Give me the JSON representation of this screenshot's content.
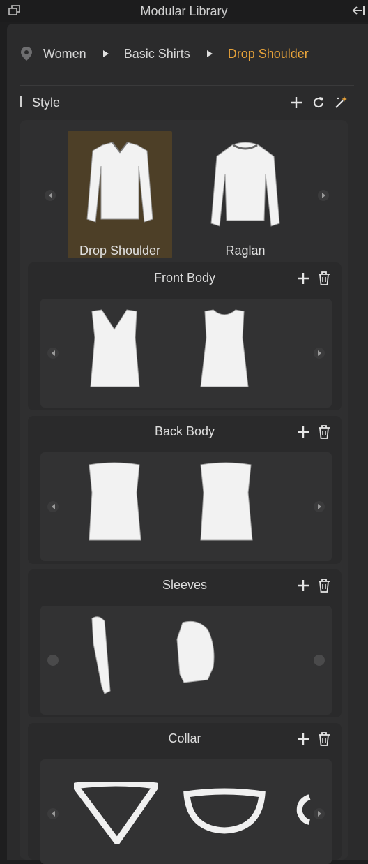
{
  "window": {
    "title": "Modular Library"
  },
  "breadcrumb": {
    "items": [
      "Women",
      "Basic Shirts",
      "Drop Shoulder"
    ]
  },
  "style": {
    "label": "Style",
    "cards": [
      {
        "label": "Drop Shoulder",
        "selected": true
      },
      {
        "label": "Raglan",
        "selected": false
      }
    ]
  },
  "sections": [
    {
      "title": "Front Body"
    },
    {
      "title": "Back Body"
    },
    {
      "title": "Sleeves"
    },
    {
      "title": "Collar"
    }
  ],
  "colors": {
    "accent": "#e8a33a",
    "selected_bg": "#4d3f27"
  }
}
